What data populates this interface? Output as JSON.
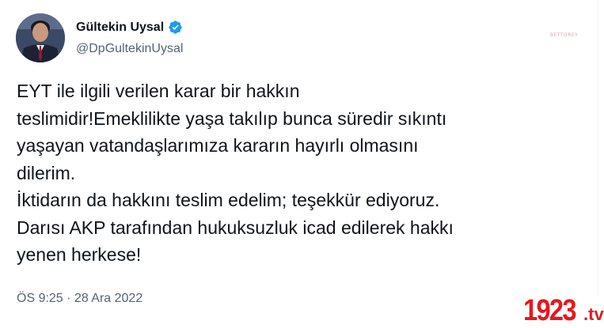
{
  "tweet": {
    "author": {
      "display_name": "Gültekin Uysal",
      "handle": "@DpGultekinUysal",
      "verified": true,
      "verified_color": "#1d9bf0"
    },
    "lines": [
      "EYT ile ilgili verilen karar bir hakkın",
      "teslimidir!Emeklilikte yaşa takılıp bunca süredir sıkıntı",
      "yaşayan vatandaşlarımıza kararın hayırlı olmasını",
      "dilerim.",
      "İktidarın da hakkını teslim edelim; teşekkür ediyoruz.",
      "Darısı AKP tarafından hukuksuzluk icad edilerek hakkı",
      "yenen herkese!"
    ],
    "timestamp": "ÖS 9:25 · 28 Ara 2022"
  },
  "watermark": {
    "small_text": "BETTORENK",
    "logo_number": "1923",
    "logo_suffix": ".tv",
    "logo_color": "#e3191f"
  }
}
